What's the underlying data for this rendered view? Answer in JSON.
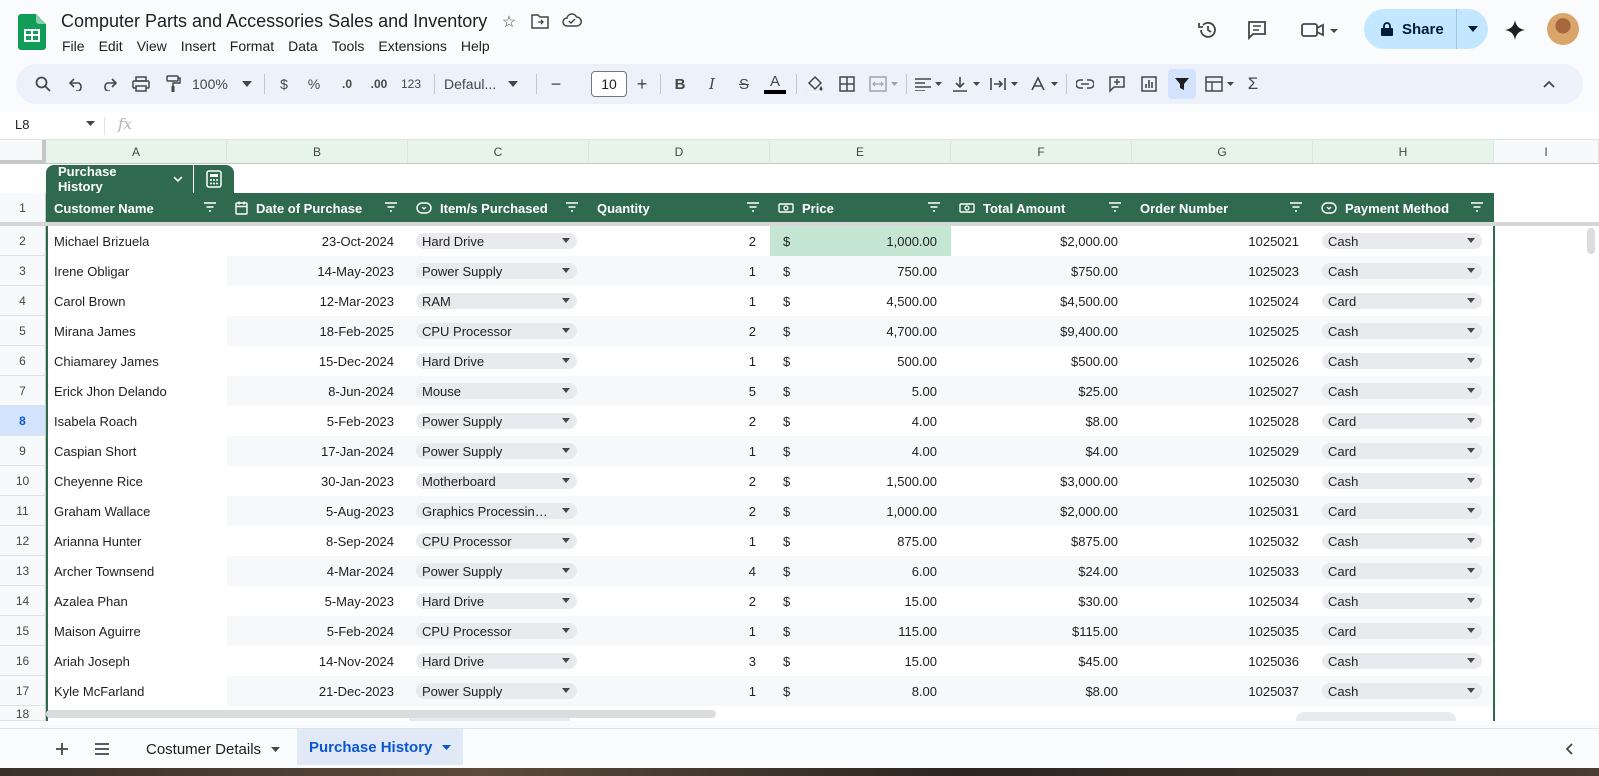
{
  "app": {
    "title": "Computer Parts and Accessories Sales and Inventory",
    "menu": [
      "File",
      "Edit",
      "View",
      "Insert",
      "Format",
      "Data",
      "Tools",
      "Extensions",
      "Help"
    ],
    "share_label": "Share"
  },
  "toolbar": {
    "zoom": "100%",
    "currency": "$",
    "percent": "%",
    "dec_less": ".0",
    "dec_more": ".00",
    "number_format": "123",
    "font": "Defaul...",
    "font_size": "10",
    "minus": "−",
    "plus": "+",
    "bold": "B",
    "italic": "I",
    "strike": "S",
    "text_color": "A",
    "sum": "Σ"
  },
  "formula_bar": {
    "cell_ref": "L8",
    "fx": "fx"
  },
  "columns": [
    "A",
    "B",
    "C",
    "D",
    "E",
    "F",
    "G",
    "H",
    "I"
  ],
  "table": {
    "name": "Purchase History",
    "headers": [
      "Customer Name",
      "Date of Purchase",
      "Item/s Purchased",
      "Quantity",
      "Price",
      "Total Amount",
      "Order Number",
      "Payment Method"
    ],
    "rows": [
      {
        "n": "2",
        "name": "Michael Brizuela",
        "date": "23-Oct-2024",
        "item": "Hard Drive",
        "qty": "2",
        "cur": "$",
        "price": "1,000.00",
        "total": "$2,000.00",
        "order": "1025021",
        "pay": "Cash"
      },
      {
        "n": "3",
        "name": "Irene Obligar",
        "date": "14-May-2023",
        "item": "Power Supply",
        "qty": "1",
        "cur": "$",
        "price": "750.00",
        "total": "$750.00",
        "order": "1025023",
        "pay": "Cash"
      },
      {
        "n": "4",
        "name": "Carol Brown",
        "date": "12-Mar-2023",
        "item": "RAM",
        "qty": "1",
        "cur": "$",
        "price": "4,500.00",
        "total": "$4,500.00",
        "order": "1025024",
        "pay": "Card"
      },
      {
        "n": "5",
        "name": "Mirana James",
        "date": "18-Feb-2025",
        "item": "CPU Processor",
        "qty": "2",
        "cur": "$",
        "price": "4,700.00",
        "total": "$9,400.00",
        "order": "1025025",
        "pay": "Cash"
      },
      {
        "n": "6",
        "name": "Chiamarey James",
        "date": "15-Dec-2024",
        "item": "Hard Drive",
        "qty": "1",
        "cur": "$",
        "price": "500.00",
        "total": "$500.00",
        "order": "1025026",
        "pay": "Cash"
      },
      {
        "n": "7",
        "name": "Erick Jhon Delando",
        "date": "8-Jun-2024",
        "item": "Mouse",
        "qty": "5",
        "cur": "$",
        "price": "5.00",
        "total": "$25.00",
        "order": "1025027",
        "pay": "Cash"
      },
      {
        "n": "8",
        "name": "Isabela Roach",
        "date": "5-Feb-2023",
        "item": "Power Supply",
        "qty": "2",
        "cur": "$",
        "price": "4.00",
        "total": "$8.00",
        "order": "1025028",
        "pay": "Card"
      },
      {
        "n": "9",
        "name": "Caspian Short",
        "date": "17-Jan-2024",
        "item": "Power Supply",
        "qty": "1",
        "cur": "$",
        "price": "4.00",
        "total": "$4.00",
        "order": "1025029",
        "pay": "Card"
      },
      {
        "n": "10",
        "name": "Cheyenne Rice",
        "date": "30-Jan-2023",
        "item": "Motherboard",
        "qty": "2",
        "cur": "$",
        "price": "1,500.00",
        "total": "$3,000.00",
        "order": "1025030",
        "pay": "Cash"
      },
      {
        "n": "11",
        "name": "Graham Wallace",
        "date": "5-Aug-2023",
        "item": "Graphics Processing Unit",
        "qty": "2",
        "cur": "$",
        "price": "1,000.00",
        "total": "$2,000.00",
        "order": "1025031",
        "pay": "Card"
      },
      {
        "n": "12",
        "name": "Arianna Hunter",
        "date": "8-Sep-2024",
        "item": "CPU Processor",
        "qty": "1",
        "cur": "$",
        "price": "875.00",
        "total": "$875.00",
        "order": "1025032",
        "pay": "Cash"
      },
      {
        "n": "13",
        "name": "Archer Townsend",
        "date": "4-Mar-2024",
        "item": "Power Supply",
        "qty": "4",
        "cur": "$",
        "price": "6.00",
        "total": "$24.00",
        "order": "1025033",
        "pay": "Card"
      },
      {
        "n": "14",
        "name": "Azalea Phan",
        "date": "5-May-2023",
        "item": "Hard Drive",
        "qty": "2",
        "cur": "$",
        "price": "15.00",
        "total": "$30.00",
        "order": "1025034",
        "pay": "Cash"
      },
      {
        "n": "15",
        "name": "Maison Aguirre",
        "date": "5-Feb-2024",
        "item": "CPU Processor",
        "qty": "1",
        "cur": "$",
        "price": "115.00",
        "total": "$115.00",
        "order": "1025035",
        "pay": "Card"
      },
      {
        "n": "16",
        "name": "Ariah Joseph",
        "date": "14-Nov-2024",
        "item": "Hard Drive",
        "qty": "3",
        "cur": "$",
        "price": "15.00",
        "total": "$45.00",
        "order": "1025036",
        "pay": "Cash"
      },
      {
        "n": "17",
        "name": "Kyle McFarland",
        "date": "21-Dec-2023",
        "item": "Power Supply",
        "qty": "1",
        "cur": "$",
        "price": "8.00",
        "total": "$8.00",
        "order": "1025037",
        "pay": "Cash"
      }
    ]
  },
  "sheets": {
    "tab1": "Costumer Details",
    "tab2": "Purchase History"
  },
  "colors": {
    "table_header": "#2f6a4f",
    "selected_cell": "#c4e6d3",
    "share_bg": "#c2e7ff",
    "active_tab": "#0b57d0"
  }
}
